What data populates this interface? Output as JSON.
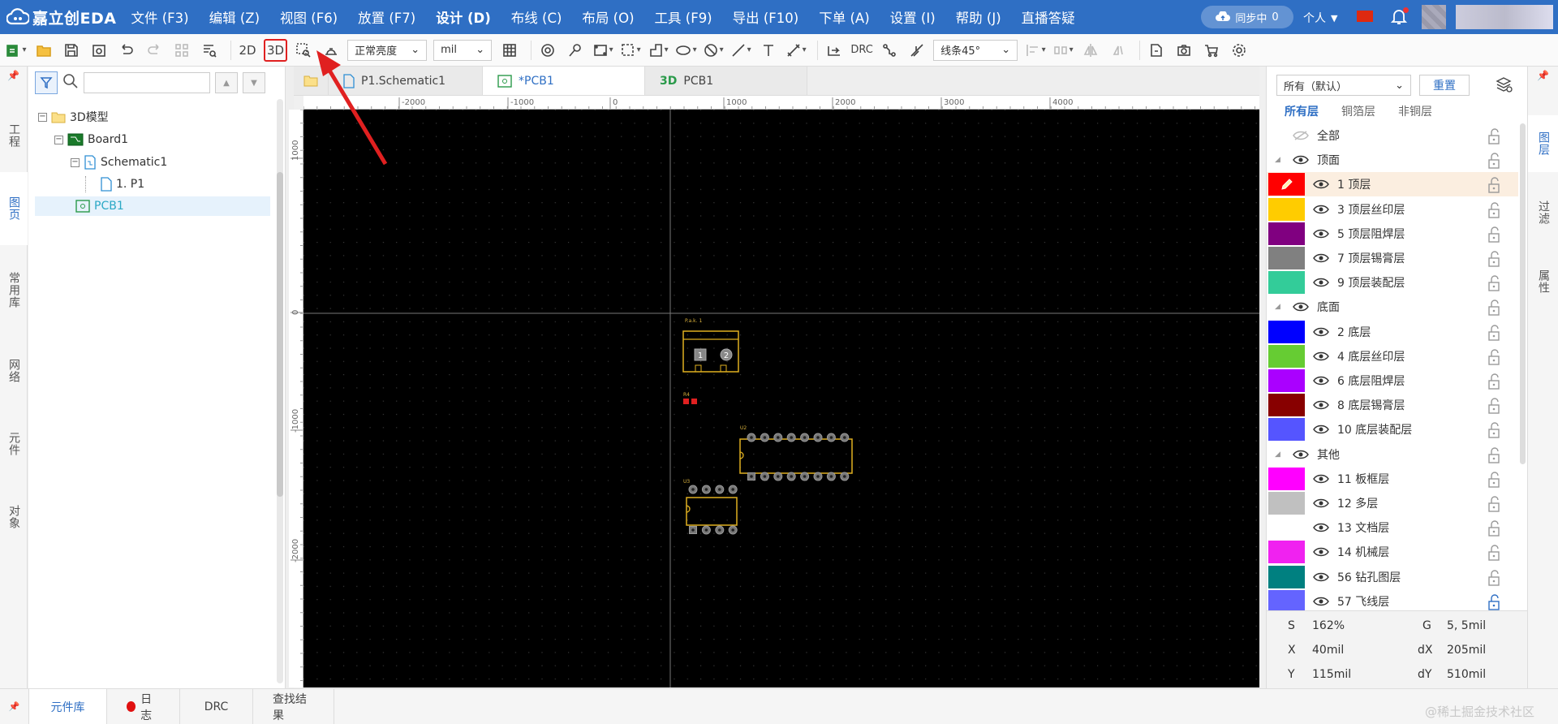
{
  "app": {
    "logo_text": "嘉立创EDA"
  },
  "menu": [
    "文件 (F3)",
    "编辑 (Z)",
    "视图 (F6)",
    "放置 (F7)",
    "设计 (D)",
    "布线 (C)",
    "布局 (O)",
    "工具 (F9)",
    "导出 (F10)",
    "下单 (A)",
    "设置 (I)",
    "帮助 (J)",
    "直播答疑"
  ],
  "header": {
    "sync_label": "同步中",
    "sync_count": "0",
    "user_label": "个人"
  },
  "toolbar": {
    "btn_2d": "2D",
    "btn_3d": "3D",
    "brightness": "正常亮度",
    "unit": "mil",
    "drc": "DRC",
    "route_mode": "线条45°"
  },
  "left_tabs": [
    "工程",
    "图页",
    "常用库",
    "网络",
    "元件",
    "对象"
  ],
  "tree": [
    "3D模型",
    "Board1",
    "Schematic1",
    "1. P1",
    "PCB1"
  ],
  "doc_tabs": [
    "P1.Schematic1",
    "*PCB1",
    "PCB1"
  ],
  "doc_tab_3d_prefix": "3D",
  "ruler": {
    "h_labels": [
      "-2000",
      "-1000",
      "0",
      "1000",
      "2000",
      "3000",
      "4000"
    ],
    "v_labels": [
      "1000",
      "0",
      "-1000",
      "-2000"
    ]
  },
  "pcb": {
    "comp1_label": "P.a.k. 1",
    "comp2_label": "R4",
    "u2_label": "U2",
    "u3_label": "U3",
    "pin1": "1",
    "pin2": "2"
  },
  "right": {
    "filter_value": "所有（默认）",
    "reset": "重置",
    "tabs": [
      "所有层",
      "铜箔层",
      "非铜层"
    ],
    "layers": [
      {
        "name": "全部",
        "color": "",
        "type": "all"
      },
      {
        "name": "顶面",
        "color": "",
        "type": "group"
      },
      {
        "name": "1 顶层",
        "color": "#ff0000",
        "type": "layer",
        "active": true
      },
      {
        "name": "3 顶层丝印层",
        "color": "#ffcc00",
        "type": "layer"
      },
      {
        "name": "5 顶层阻焊层",
        "color": "#800080",
        "type": "layer"
      },
      {
        "name": "7 顶层锡膏层",
        "color": "#808080",
        "type": "layer"
      },
      {
        "name": "9 顶层装配层",
        "color": "#33cc99",
        "type": "layer"
      },
      {
        "name": "底面",
        "color": "",
        "type": "group"
      },
      {
        "name": "2 底层",
        "color": "#0000ff",
        "type": "layer"
      },
      {
        "name": "4 底层丝印层",
        "color": "#66cc33",
        "type": "layer"
      },
      {
        "name": "6 底层阻焊层",
        "color": "#aa00ff",
        "type": "layer"
      },
      {
        "name": "8 底层锡膏层",
        "color": "#880000",
        "type": "layer"
      },
      {
        "name": "10 底层装配层",
        "color": "#5555ff",
        "type": "layer"
      },
      {
        "name": "其他",
        "color": "",
        "type": "group"
      },
      {
        "name": "11 板框层",
        "color": "#ff00ff",
        "type": "layer"
      },
      {
        "name": "12 多层",
        "color": "#c0c0c0",
        "type": "layer"
      },
      {
        "name": "13 文档层",
        "color": "#ffffff",
        "type": "layer"
      },
      {
        "name": "14 机械层",
        "color": "#f022f0",
        "type": "layer"
      },
      {
        "name": "56 钻孔图层",
        "color": "#008080",
        "type": "layer"
      },
      {
        "name": "57 飞线层",
        "color": "#6464ff",
        "type": "layer",
        "lock_blue": true
      }
    ],
    "status": {
      "S_label": "S",
      "S": "162%",
      "G_label": "G",
      "G": "5, 5mil",
      "X_label": "X",
      "X": "40mil",
      "dX_label": "dX",
      "dX": "205mil",
      "Y_label": "Y",
      "Y": "115mil",
      "dY_label": "dY",
      "dY": "510mil"
    }
  },
  "right_tabs": [
    "图层",
    "过滤",
    "属性"
  ],
  "bottom_tabs": [
    "元件库",
    "日志",
    "DRC",
    "查找结果"
  ],
  "watermark": "@稀土掘金技术社区"
}
